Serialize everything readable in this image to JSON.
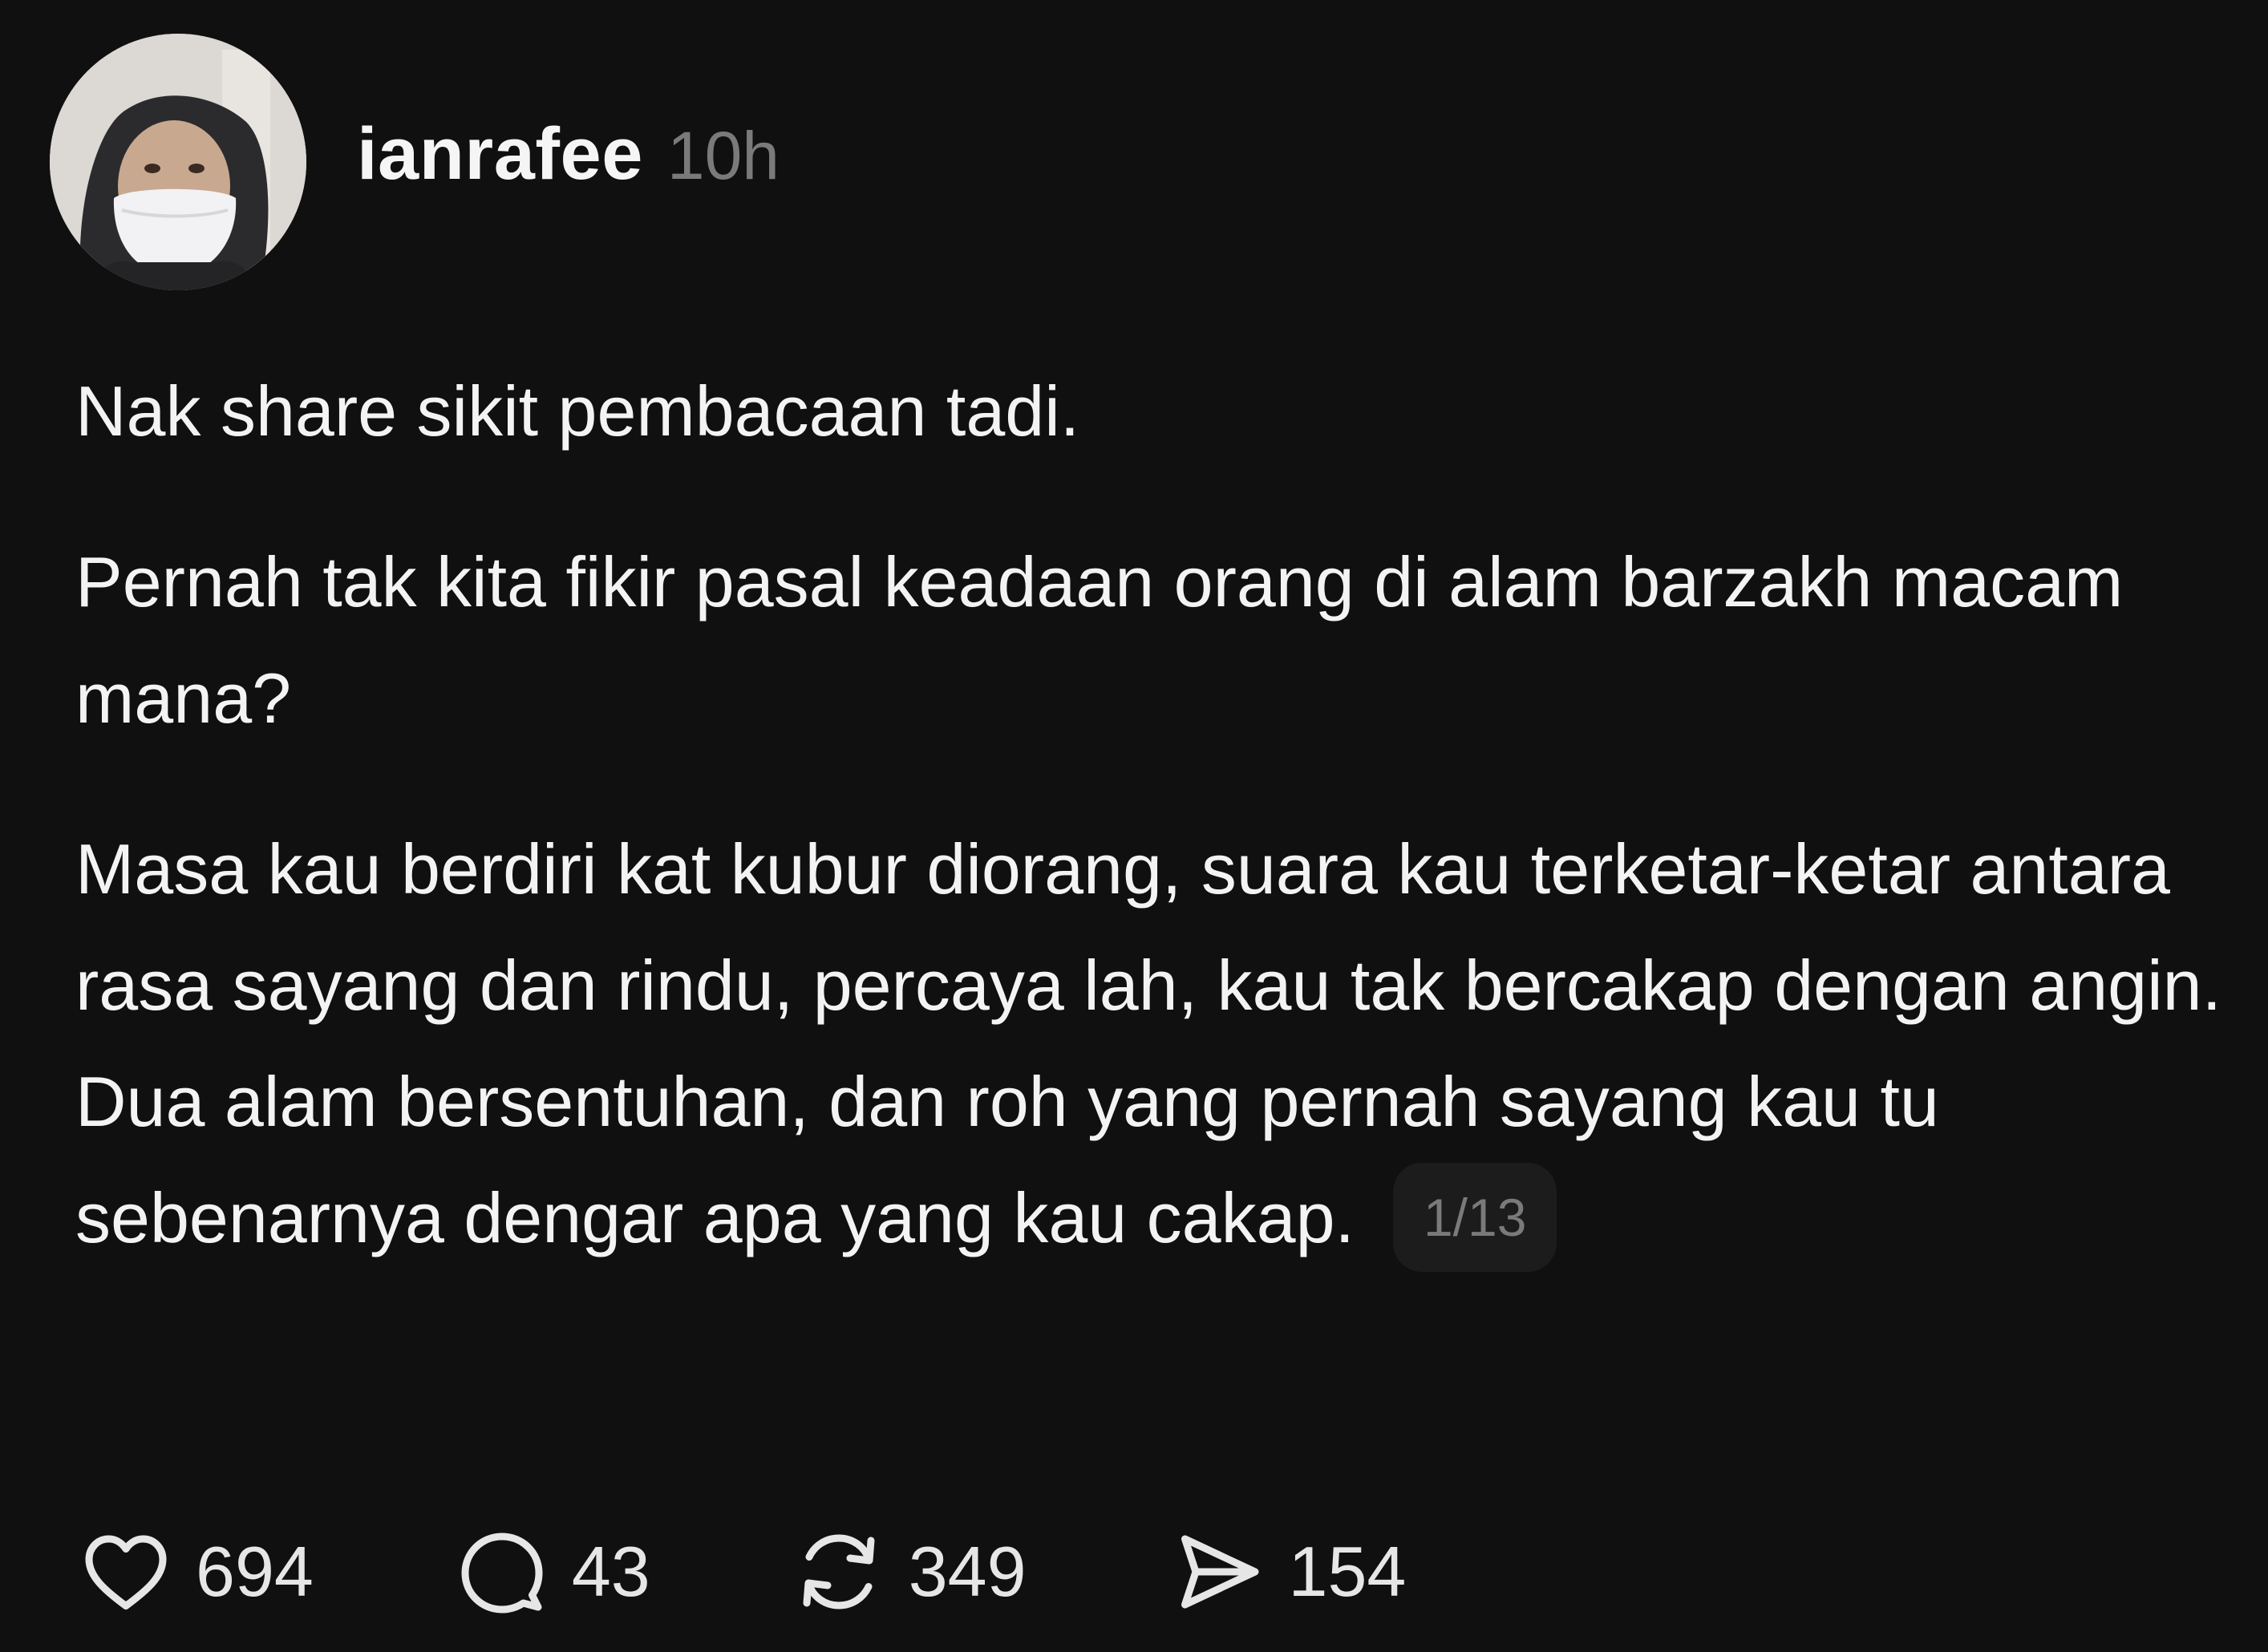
{
  "post": {
    "username": "ianrafee",
    "time": "10h",
    "paragraphs": [
      "Nak share sikit pembacaan tadi.",
      "Pernah tak kita fikir pasal keadaan orang di alam barzakh macam mana?",
      "Masa kau berdiri kat kubur diorang, suara kau terketar-ketar antara rasa sayang dan rindu, percaya lah, kau tak bercakap dengan angin. Dua alam bersentuhan, dan roh yang pernah sayang kau tu sebenarnya dengar apa yang kau cakap."
    ],
    "page_counter": "1/13",
    "actions": {
      "likes": "694",
      "replies": "43",
      "reposts": "349",
      "shares": "154"
    }
  },
  "icons": {
    "like": "heart-icon",
    "reply": "speech-bubble-icon",
    "repost": "repost-arrows-icon",
    "share": "send-icon"
  },
  "colors": {
    "background": "#101010",
    "text": "#f3f3f3",
    "muted": "#7a7a7a"
  }
}
